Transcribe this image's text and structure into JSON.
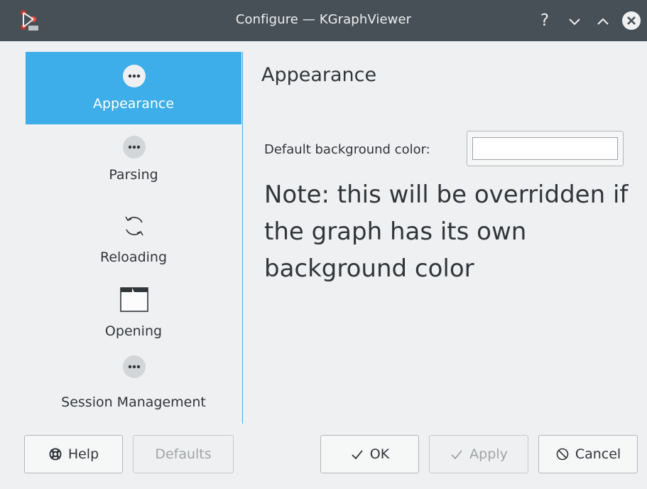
{
  "window": {
    "title": "Configure — KGraphViewer",
    "controls": {
      "help": "?",
      "minimize": "⌄",
      "maximize": "⌃"
    }
  },
  "sidebar": {
    "items": [
      {
        "label": "Appearance",
        "icon": "more-dots-icon",
        "selected": true
      },
      {
        "label": "Parsing",
        "icon": "more-dots-icon",
        "selected": false
      },
      {
        "label": "Reloading",
        "icon": "reload-icon",
        "selected": false
      },
      {
        "label": "Opening",
        "icon": "folder-icon",
        "selected": false
      },
      {
        "label": "Session Management",
        "icon": "more-dots-icon",
        "selected": false
      }
    ]
  },
  "page": {
    "header": "Appearance",
    "bg_color_label": "Default background color:",
    "bg_color_value": "#ffffff",
    "note": "Note: this will be overridden if the graph has its own background color"
  },
  "buttons": {
    "help": "Help",
    "defaults": "Defaults",
    "ok": "OK",
    "apply": "Apply",
    "cancel": "Cancel"
  },
  "colors": {
    "accent": "#3daee9",
    "titlebar": "#475057",
    "window_bg": "#eff0f1",
    "text": "#31363b"
  }
}
